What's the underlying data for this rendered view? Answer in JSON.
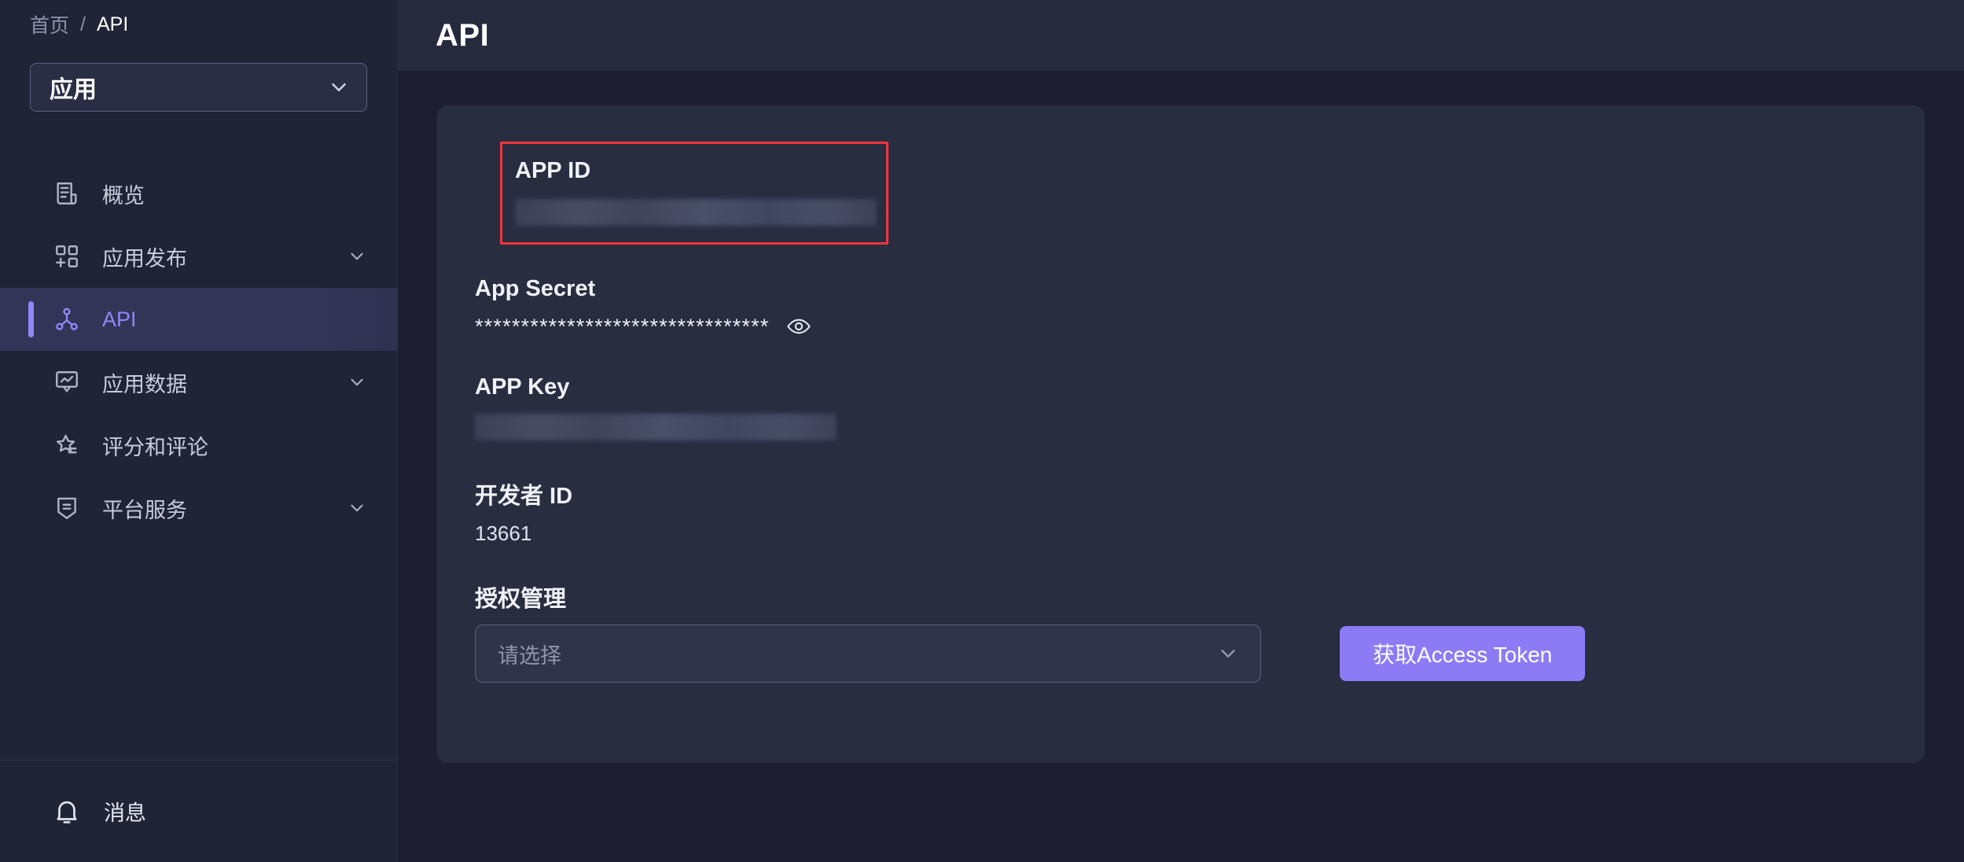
{
  "breadcrumb": {
    "home": "首页",
    "separator": "/",
    "current": "API"
  },
  "sidebar": {
    "app_selector": {
      "label": "应用",
      "icon": "chevron-down-icon"
    },
    "items": [
      {
        "label": "概览",
        "icon": "document-list-icon",
        "active": false,
        "expandable": false
      },
      {
        "label": "应用发布",
        "icon": "grid-plus-icon",
        "active": false,
        "expandable": true
      },
      {
        "label": "API",
        "icon": "api-node-icon",
        "active": true,
        "expandable": false
      },
      {
        "label": "应用数据",
        "icon": "chart-board-icon",
        "active": false,
        "expandable": true
      },
      {
        "label": "评分和评论",
        "icon": "star-list-icon",
        "active": false,
        "expandable": false
      },
      {
        "label": "平台服务",
        "icon": "shield-lines-icon",
        "active": false,
        "expandable": true
      }
    ],
    "footer": {
      "label": "消息",
      "icon": "bell-icon"
    }
  },
  "header": {
    "title": "API"
  },
  "main": {
    "fields": [
      {
        "key": "app_id",
        "label": "APP ID",
        "value_type": "redacted",
        "value": "",
        "highlighted": true
      },
      {
        "key": "app_secret",
        "label": "App Secret",
        "value_type": "masked",
        "value": "********************************",
        "toggle_icon": "eye-icon"
      },
      {
        "key": "app_key",
        "label": "APP Key",
        "value_type": "redacted",
        "value": ""
      },
      {
        "key": "developer_id",
        "label": "开发者 ID",
        "value_type": "text",
        "value": "13661"
      },
      {
        "key": "auth_management",
        "label": "授权管理",
        "value_type": "select"
      }
    ],
    "select": {
      "placeholder": "请选择",
      "value": "",
      "icon": "chevron-down-icon"
    },
    "token_button": {
      "label": "获取Access Token"
    }
  },
  "colors": {
    "page_background": "#1d1f31",
    "sidebar_background": "#212437",
    "card_background": "#282d40",
    "header_background": "#262a3d",
    "accent_purple": "#9186f5",
    "button_purple": "#8c7bf5",
    "highlight_red": "#f8343f",
    "active_nav_background": "#343459"
  }
}
